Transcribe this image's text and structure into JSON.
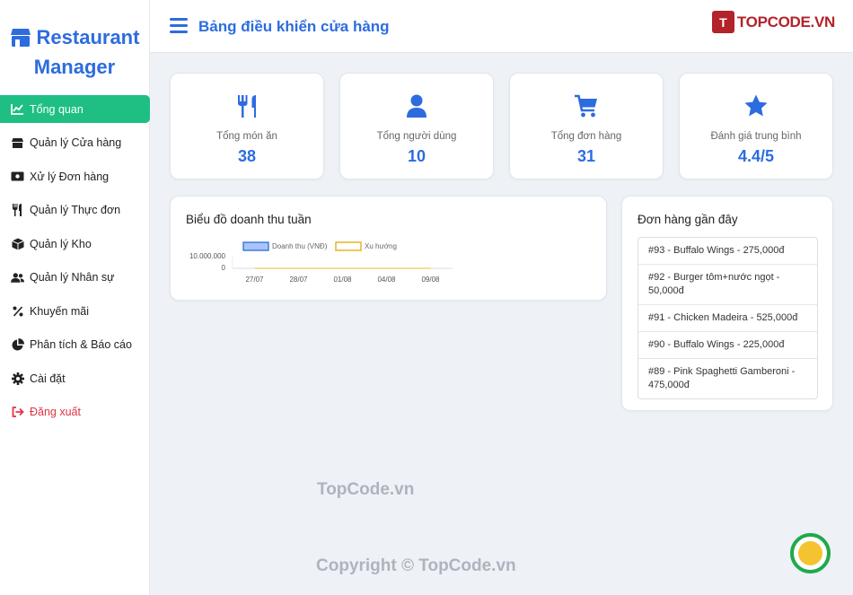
{
  "brand": {
    "line1": "Restaurant",
    "line2": "Manager"
  },
  "sidebar": {
    "items": [
      {
        "label": "Tổng quan",
        "icon": "chart-line-icon",
        "active": true
      },
      {
        "label": "Quản lý Cửa hàng",
        "icon": "store-icon"
      },
      {
        "label": "Xử lý Đơn hàng",
        "icon": "money-bill-icon"
      },
      {
        "label": "Quản lý Thực đơn",
        "icon": "utensils-icon"
      },
      {
        "label": "Quản lý Kho",
        "icon": "box-icon"
      },
      {
        "label": "Quản lý Nhân sự",
        "icon": "users-icon"
      },
      {
        "label": "Khuyến mãi",
        "icon": "percent-icon"
      },
      {
        "label": "Phân tích & Báo cáo",
        "icon": "pie-chart-icon"
      },
      {
        "label": "Cài đặt",
        "icon": "gear-icon"
      },
      {
        "label": "Đăng xuất",
        "icon": "sign-out-icon",
        "danger": true
      }
    ]
  },
  "header": {
    "title": "Bảng điều khiển cửa hàng"
  },
  "watermark": {
    "logo_text": "TOPCODE.VN",
    "mid": "TopCode.vn",
    "bottom": "Copyright © TopCode.vn"
  },
  "stats": [
    {
      "label": "Tổng món ăn",
      "value": "38",
      "icon": "utensils-icon"
    },
    {
      "label": "Tổng người dùng",
      "value": "10",
      "icon": "user-icon"
    },
    {
      "label": "Tổng đơn hàng",
      "value": "31",
      "icon": "shopping-cart-icon"
    },
    {
      "label": "Đánh giá trung bình",
      "value": "4.4/5",
      "icon": "star-icon"
    }
  ],
  "chart": {
    "title": "Biểu đồ doanh thu tuần",
    "legend": [
      "Doanh thu (VNĐ)",
      "Xu hướng"
    ],
    "y_ticks": [
      "10.000.000",
      "0"
    ],
    "x_labels": [
      "27/07",
      "28/07",
      "01/08",
      "04/08",
      "09/08"
    ]
  },
  "chart_data": {
    "type": "bar",
    "title": "Biểu đồ doanh thu tuần",
    "categories": [
      "27/07",
      "28/07",
      "01/08",
      "04/08",
      "09/08"
    ],
    "series": [
      {
        "name": "Doanh thu (VNĐ)",
        "values": [
          0,
          0,
          0,
          0,
          0
        ]
      },
      {
        "name": "Xu hướng",
        "values": [
          0,
          0,
          0,
          0,
          0
        ]
      }
    ],
    "ylim": [
      0,
      10000000
    ],
    "legend": "top",
    "colors": {
      "bars": "#a9c4f5",
      "bars_border": "#2d6cdf",
      "trend": "#e8b931"
    }
  },
  "orders": {
    "title": "Đơn hàng gần đây",
    "items": [
      "#93 - Buffalo Wings - 275,000đ",
      "#92 - Burger tôm+nước ngọt - 50,000đ",
      "#91 - Chicken Madeira - 525,000đ",
      "#90 - Buffalo Wings - 225,000đ",
      "#89 - Pink Spaghetti Gamberoni - 475,000đ"
    ]
  },
  "colors": {
    "accent": "#2d6cdf",
    "active": "#1fbf84",
    "danger": "#e03545"
  }
}
